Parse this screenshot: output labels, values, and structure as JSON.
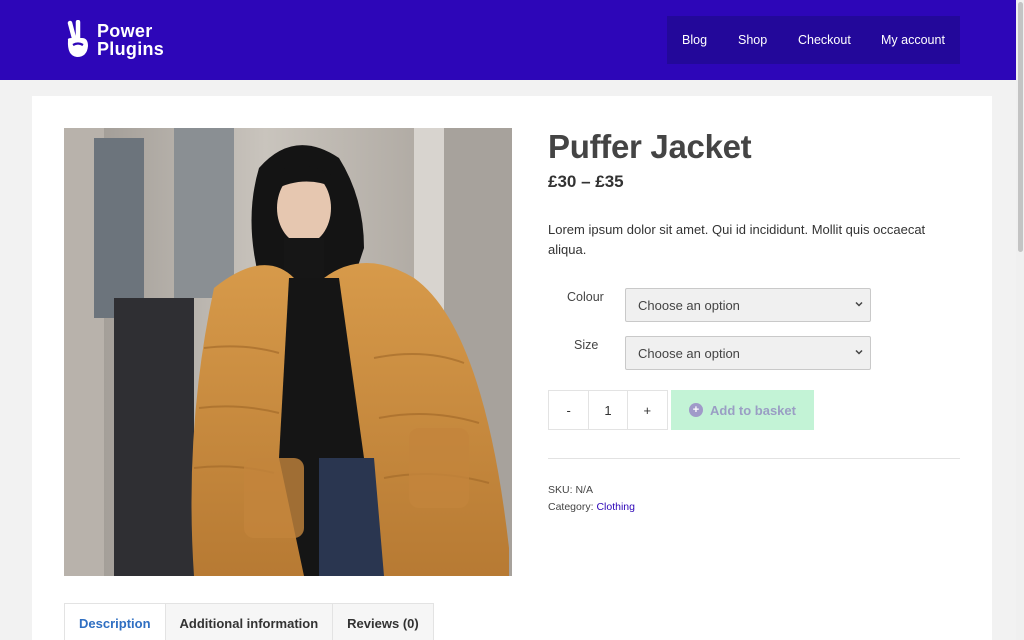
{
  "brand": {
    "line1": "Power",
    "line2": "Plugins"
  },
  "nav": {
    "items": [
      "Blog",
      "Shop",
      "Checkout",
      "My account"
    ]
  },
  "product": {
    "title": "Puffer Jacket",
    "price": "£30 – £35",
    "description": "Lorem ipsum dolor sit amet. Qui id incididunt. Mollit quis occaecat aliqua."
  },
  "variations": {
    "colour_label": "Colour",
    "colour_value": "Choose an option",
    "size_label": "Size",
    "size_value": "Choose an option"
  },
  "cart": {
    "minus": "-",
    "quantity": "1",
    "plus": "+",
    "add_label": "Add to basket"
  },
  "meta": {
    "sku_label": "SKU:",
    "sku_value": "N/A",
    "category_label": "Category:",
    "category_value": "Clothing"
  },
  "tabs": [
    "Description",
    "Additional information",
    "Reviews (0)"
  ],
  "colors": {
    "header": "#2d06b8",
    "nav_bg": "#23089a",
    "add_button": "#c3f3d6",
    "active_tab": "#2f6fc2"
  }
}
